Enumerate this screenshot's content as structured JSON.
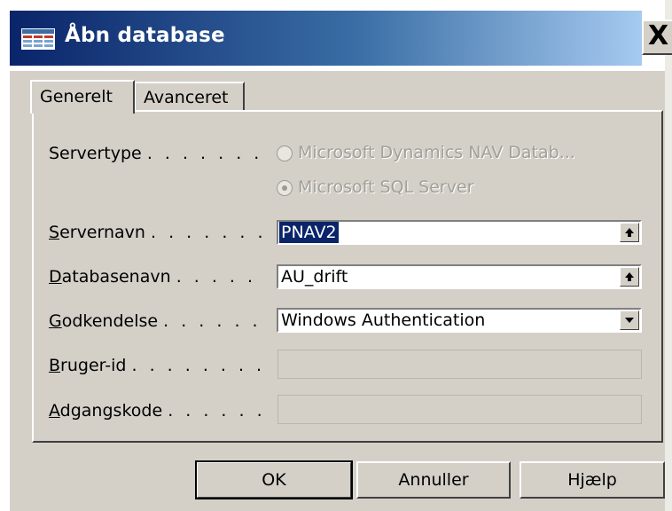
{
  "window": {
    "title": "Åbn database",
    "close_label": "X"
  },
  "tabs": [
    {
      "label": "Generelt",
      "active": true
    },
    {
      "label": "Avanceret",
      "active": false
    }
  ],
  "form": {
    "servertype": {
      "label": "Servertype",
      "dots": ". . . . . . .",
      "options": [
        {
          "label": "Microsoft Dynamics NAV Datab...",
          "selected": false
        },
        {
          "label": "Microsoft SQL Server",
          "selected": true
        }
      ]
    },
    "servernavn": {
      "label_prefix": "S",
      "label_rest": "ervernavn",
      "dots": ". . . . . . .",
      "value": "PNAV2"
    },
    "databasenavn": {
      "label_prefix": "D",
      "label_rest": "atabasenavn",
      "dots": ". . . . .",
      "value": "AU_drift"
    },
    "godkendelse": {
      "label_prefix": "G",
      "label_rest": "odkendelse",
      "dots": ". . . . . .",
      "value": "Windows Authentication"
    },
    "bruger_id": {
      "label_prefix": "B",
      "label_rest": "ruger-id",
      "dots": ". . . . . . . .",
      "value": ""
    },
    "adgangskode": {
      "label_prefix": "A",
      "label_rest": "dgangskode",
      "dots": ". . . . . .",
      "value": ""
    }
  },
  "buttons": {
    "ok": "OK",
    "cancel": "Annuller",
    "help": "Hjælp"
  }
}
